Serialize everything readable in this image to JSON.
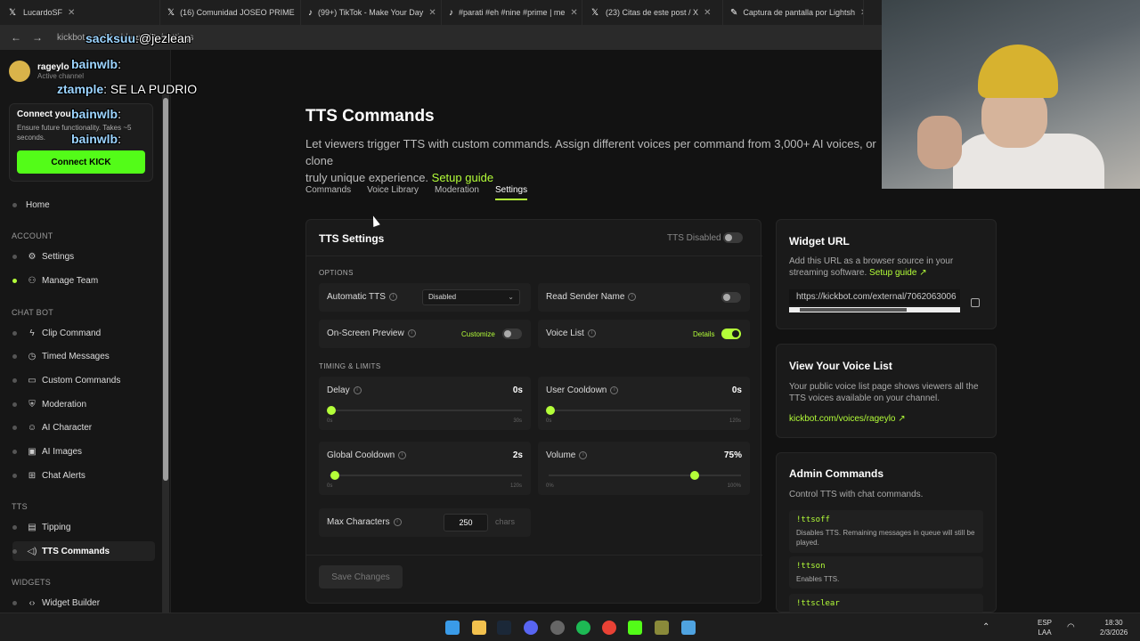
{
  "browser": {
    "tabs": [
      {
        "label": "LucardoSF"
      },
      {
        "label": "(16) Comunidad JOSEO PRIME"
      },
      {
        "label": "(99+) TikTok - Make Your Day"
      },
      {
        "label": "#parati #eh #nine #prime | me"
      },
      {
        "label": "(23) Citas de este post / X"
      },
      {
        "label": "Captura de pantalla por Lightsh"
      }
    ],
    "address": "kickbot.com/dashboard/tts/settings"
  },
  "sidebar": {
    "channel_name": "rageylo",
    "channel_sub": "Active channel",
    "connect_title": "Connect your",
    "connect_text": "Ensure future functionality. Takes ~5 seconds.",
    "connect_button": "Connect KICK",
    "sections": {
      "account": "ACCOUNT",
      "chatbot": "CHAT BOT",
      "tts": "TTS",
      "widgets": "WIDGETS"
    },
    "items": {
      "home": "Home",
      "settings": "Settings",
      "manage_team": "Manage Team",
      "clip_command": "Clip Command",
      "timed_messages": "Timed Messages",
      "custom_commands": "Custom Commands",
      "moderation": "Moderation",
      "ai_character": "AI Character",
      "ai_images": "AI Images",
      "chat_alerts": "Chat Alerts",
      "tipping": "Tipping",
      "tts_commands": "TTS Commands",
      "widget_builder": "Widget Builder"
    }
  },
  "main": {
    "title": "TTS Commands",
    "subtitle": "Let viewers trigger TTS with custom commands. Assign different voices per command from 3,000+ AI voices, or clone",
    "subtitle2": "truly unique experience.",
    "setup_guide": "Setup guide",
    "tabs": [
      "Commands",
      "Voice Library",
      "Moderation",
      "Settings"
    ]
  },
  "settings_card": {
    "title": "TTS Settings",
    "tts_status": "TTS Disabled",
    "options_label": "OPTIONS",
    "automatic_tts": "Automatic TTS",
    "automatic_tts_value": "Disabled",
    "read_sender_name": "Read Sender Name",
    "on_screen_preview": "On-Screen Preview",
    "customize": "Customize",
    "voice_list": "Voice List",
    "details": "Details",
    "timing_label": "TIMING & LIMITS",
    "delay": {
      "label": "Delay",
      "value": "0s",
      "min": "0s",
      "max": "30s",
      "fraction": 0
    },
    "user_cooldown": {
      "label": "User Cooldown",
      "value": "0s",
      "min": "0s",
      "max": "120s",
      "fraction": 0
    },
    "global_cooldown": {
      "label": "Global Cooldown",
      "value": "2s",
      "min": "0s",
      "max": "120s",
      "fraction": 0.017
    },
    "volume": {
      "label": "Volume",
      "value": "75%",
      "min": "0%",
      "max": "100%",
      "fraction": 0.75
    },
    "max_characters": "Max Characters",
    "max_characters_value": "250",
    "chars_unit": "chars",
    "save": "Save Changes"
  },
  "widget_card": {
    "title": "Widget URL",
    "text": "Add this URL as a browser source in your streaming software.",
    "setup_guide": "Setup guide",
    "url": "https://kickbot.com/external/7062063006"
  },
  "voicelist_card": {
    "title": "View Your Voice List",
    "text": "Your public voice list page shows viewers all the TTS voices available on your channel.",
    "link": "kickbot.com/voices/rageylo"
  },
  "admin_card": {
    "title": "Admin Commands",
    "text": "Control TTS with chat commands.",
    "commands": [
      {
        "cmd": "!ttsoff",
        "desc": "Disables TTS. Remaining messages in queue will still be played."
      },
      {
        "cmd": "!ttson",
        "desc": "Enables TTS."
      },
      {
        "cmd": "!ttsclear",
        "desc": ""
      }
    ]
  },
  "chat_overlay": [
    {
      "name": "sacksuu",
      "msg": ":@jezlean"
    },
    {
      "name": "bainwlb",
      "msg": ":"
    },
    {
      "name": "ztample",
      "msg": ": SE LA PUDRIO"
    },
    {
      "name": "bainwlb",
      "msg": ":"
    },
    {
      "name": "bainwlb",
      "msg": ":"
    }
  ],
  "tray": {
    "lang": "ESP",
    "lang2": "LAA",
    "time": "18:30",
    "date": "2/3/2026"
  },
  "colors": {
    "accent": "#b4ff39",
    "kick": "#53fc18",
    "bg": "#121212"
  }
}
